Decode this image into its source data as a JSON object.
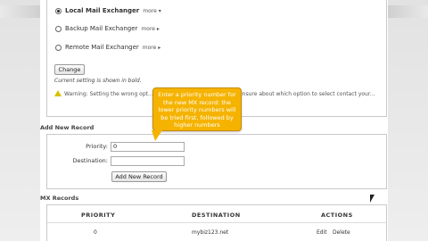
{
  "mx_options": [
    {
      "label": "Local Mail Exchanger",
      "more": "more ▾",
      "selected": true
    },
    {
      "label": "Backup Mail Exchanger",
      "more": "more ▸",
      "selected": false
    },
    {
      "label": "Remote Mail Exchanger",
      "more": "more ▸",
      "selected": false
    }
  ],
  "change_button": "Change",
  "current_setting_note": "Current setting is shown in bold.",
  "warning_text": "Warning: Setting the wrong opt... on your server. If you are at all unsure about which option to select contact your...",
  "tooltip_text": "Enter a priority number for the new MX record: the lower priority numbers will be tried first, followed by higher numbers",
  "add_new_record": {
    "title": "Add New Record",
    "priority_label": "Priority:",
    "priority_value": "0",
    "destination_label": "Destination:",
    "destination_value": "",
    "button": "Add New Record"
  },
  "mx_records": {
    "title": "MX Records",
    "headers": [
      "Priority",
      "Destination",
      "Actions"
    ],
    "rows": [
      {
        "priority": "0",
        "destination": "mybiz123.net",
        "edit": "Edit",
        "delete": "Delete"
      }
    ]
  }
}
